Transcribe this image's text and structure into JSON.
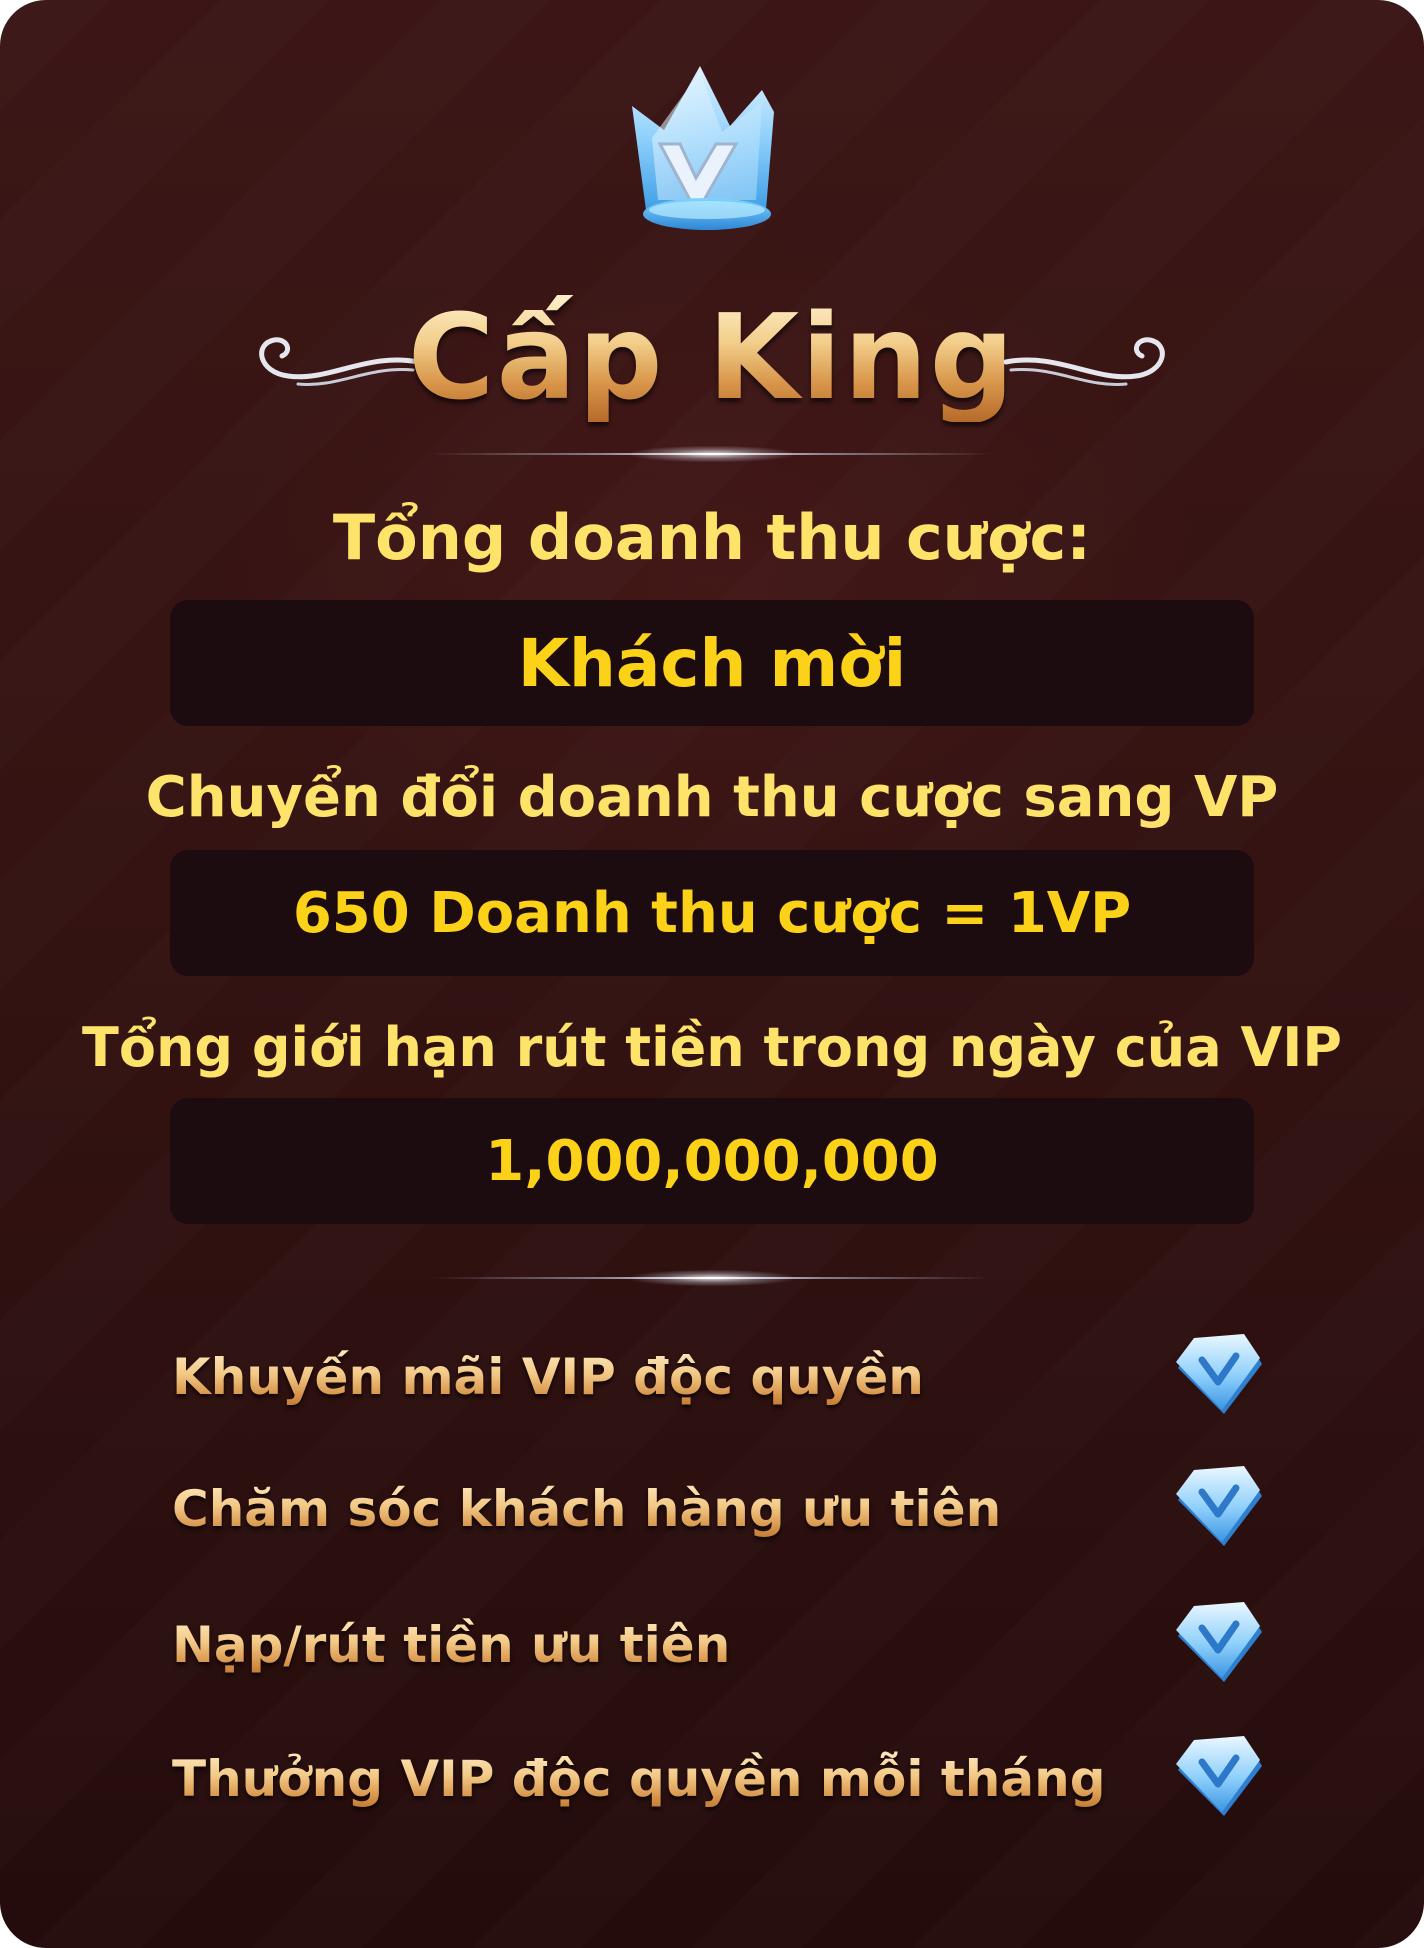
{
  "level": {
    "title": "Cấp King",
    "crown_icon": "crown-v-icon"
  },
  "sections": [
    {
      "heading": "Tổng doanh thu cược:",
      "value": "Khách mời"
    },
    {
      "heading": "Chuyển đổi doanh thu cược sang VP",
      "value": "650 Doanh thu cược = 1VP"
    },
    {
      "heading": "Tổng giới hạn rút tiền trong ngày của VIP",
      "value": "1,000,000,000"
    }
  ],
  "benefits": [
    {
      "label": "Khuyến mãi VIP độc quyền",
      "icon": "check-badge-icon"
    },
    {
      "label": "Chăm sóc khách hàng ưu tiên",
      "icon": "check-badge-icon"
    },
    {
      "label": "Nạp/rút tiền ưu tiên",
      "icon": "check-badge-icon"
    },
    {
      "label": "Thưởng VIP độc quyền mỗi tháng",
      "icon": "check-badge-icon"
    }
  ],
  "colors": {
    "background": "#361413",
    "value_box": "#1c0c0f",
    "heading_text": "#fde36a",
    "value_text": "#fcd218",
    "gold_gradient_top": "#fff2cf",
    "gold_gradient_bottom": "#b56a2a",
    "badge_blue": "#6fc3f5"
  }
}
